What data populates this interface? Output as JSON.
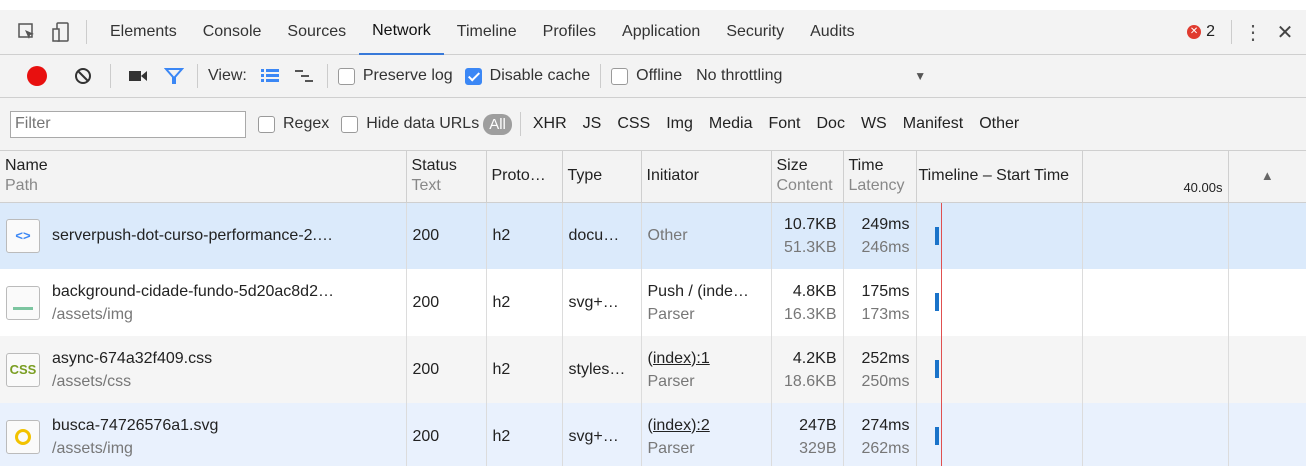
{
  "tabs": [
    "Elements",
    "Console",
    "Sources",
    "Network",
    "Timeline",
    "Profiles",
    "Application",
    "Security",
    "Audits"
  ],
  "active_tab": "Network",
  "error_count": "2",
  "toolbar": {
    "view_label": "View:",
    "preserve_log": "Preserve log",
    "disable_cache": "Disable cache",
    "offline": "Offline",
    "throttling": "No throttling",
    "disable_cache_checked": true
  },
  "filterbar": {
    "placeholder": "Filter",
    "regex": "Regex",
    "hide_data_urls": "Hide data URLs",
    "all": "All",
    "types": [
      "XHR",
      "JS",
      "CSS",
      "Img",
      "Media",
      "Font",
      "Doc",
      "WS",
      "Manifest",
      "Other"
    ]
  },
  "columns": {
    "name": "Name",
    "name_sub": "Path",
    "status": "Status",
    "status_sub": "Text",
    "protocol": "Proto…",
    "type": "Type",
    "initiator": "Initiator",
    "size": "Size",
    "size_sub": "Content",
    "time": "Time",
    "time_sub": "Latency",
    "timeline": "Timeline – Start Time",
    "timeline_mark": "40.00s"
  },
  "rows": [
    {
      "icon": "html-file-icon",
      "name": "serverpush-dot-curso-performance-2.…",
      "path": "",
      "status": "200",
      "protocol": "h2",
      "type": "docu…",
      "initiator": "Other",
      "initiator_sub": "",
      "size": "10.7KB",
      "content": "51.3KB",
      "time": "249ms",
      "latency": "246ms",
      "bar_color": "#1a73c9"
    },
    {
      "icon": "image-file-icon",
      "name": "background-cidade-fundo-5d20ac8d2…",
      "path": "/assets/img",
      "status": "200",
      "protocol": "h2",
      "type": "svg+…",
      "initiator": "Push / (inde…",
      "initiator_sub": "Parser",
      "size": "4.8KB",
      "content": "16.3KB",
      "time": "175ms",
      "latency": "173ms",
      "bar_color": "#1a73c9"
    },
    {
      "icon": "css-file-icon",
      "name": "async-674a32f409.css",
      "path": "/assets/css",
      "status": "200",
      "protocol": "h2",
      "type": "styles…",
      "initiator": "(index):1",
      "initiator_sub": "Parser",
      "size": "4.2KB",
      "content": "18.6KB",
      "time": "252ms",
      "latency": "250ms",
      "bar_color": "#1a73c9"
    },
    {
      "icon": "svg-file-icon",
      "name": "busca-74726576a1.svg",
      "path": "/assets/img",
      "status": "200",
      "protocol": "h2",
      "type": "svg+…",
      "initiator": "(index):2",
      "initiator_sub": "Parser",
      "size": "247B",
      "content": "329B",
      "time": "274ms",
      "latency": "262ms",
      "bar_color": "#1a73c9"
    }
  ]
}
